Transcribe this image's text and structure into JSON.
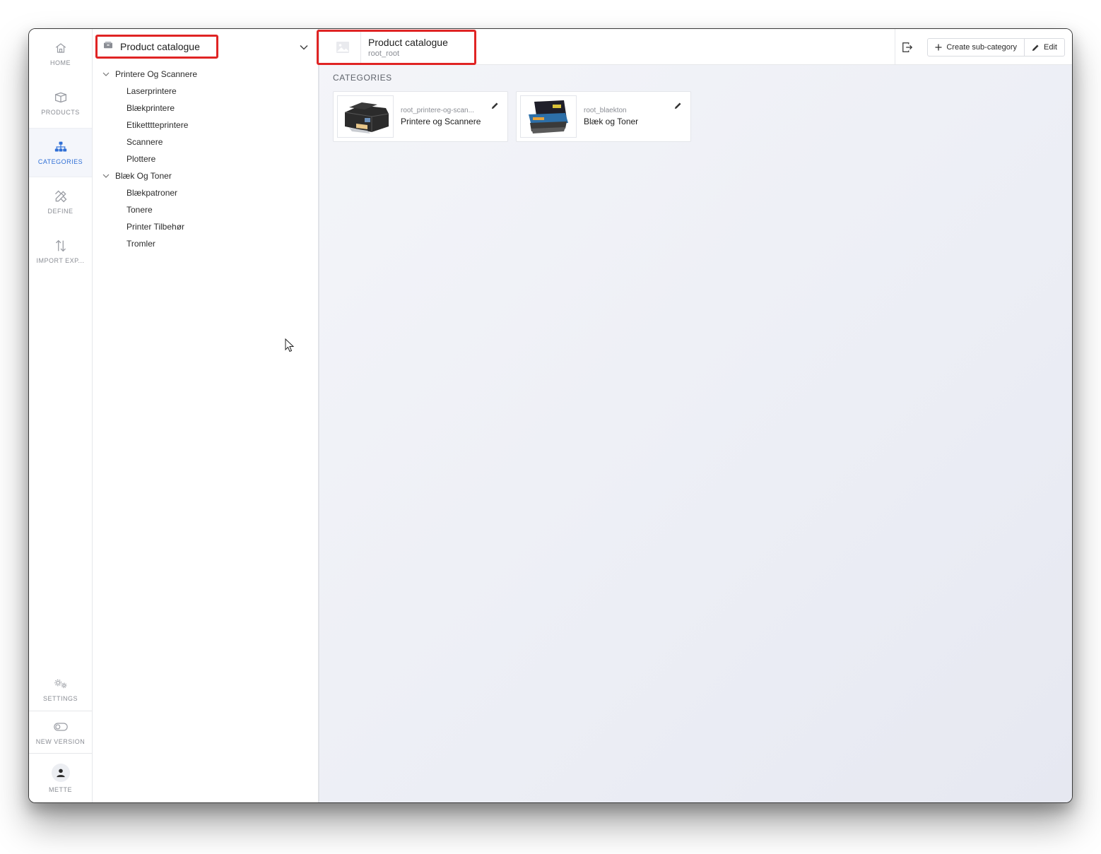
{
  "nav": {
    "items": [
      {
        "label": "HOME",
        "icon": "home-icon"
      },
      {
        "label": "PRODUCTS",
        "icon": "box-icon"
      },
      {
        "label": "CATEGORIES",
        "icon": "sitemap-icon",
        "active": true
      },
      {
        "label": "DEFINE",
        "icon": "pencil-ruler-icon"
      },
      {
        "label": "IMPORT EXP...",
        "icon": "arrows-up-down-icon"
      }
    ],
    "settings_label": "SETTINGS",
    "new_version_label": "NEW VERSION",
    "user_label": "METTE"
  },
  "tree": {
    "title": "Product catalogue",
    "groups": [
      {
        "label": "Printere Og Scannere",
        "children": [
          "Laserprintere",
          "Blækprintere",
          "Etiketttteprintere",
          "Scannere",
          "Plottere"
        ]
      },
      {
        "label": "Blæk Og Toner",
        "children": [
          "Blækpatroner",
          "Tonere",
          "Printer Tilbehør",
          "Tromler"
        ]
      }
    ]
  },
  "header": {
    "title": "Product catalogue",
    "code": "root_root",
    "create_label": "Create sub-category",
    "edit_label": "Edit"
  },
  "main": {
    "section_label": "CATEGORIES",
    "cards": [
      {
        "code": "root_printere-og-scan...",
        "name": "Printere og Scannere",
        "image": "printer-image"
      },
      {
        "code": "root_blaekton",
        "name": "Blæk og Toner",
        "image": "toner-image"
      }
    ]
  },
  "colors": {
    "accent": "#2f6fd6",
    "highlight_border": "#e02424"
  }
}
